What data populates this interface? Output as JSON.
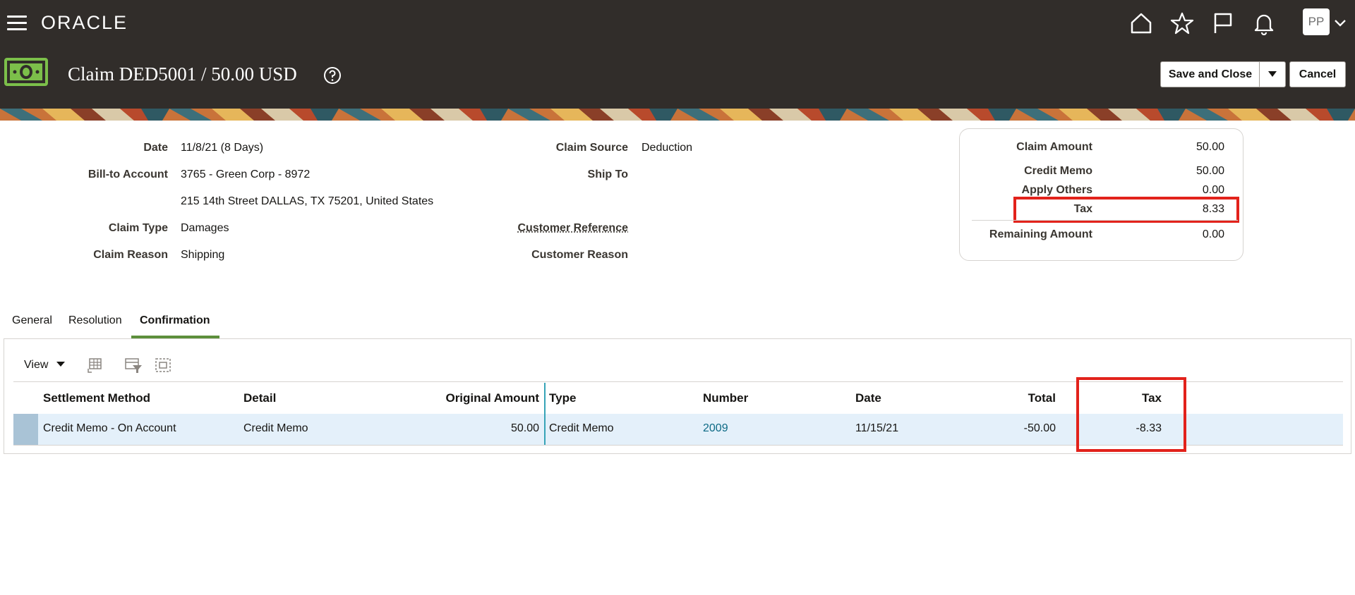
{
  "header": {
    "logo": "ORACLE",
    "avatar_initials": "PP",
    "title": "Claim DED5001 / 50.00 USD"
  },
  "actions": {
    "save_close": "Save and Close",
    "cancel": "Cancel"
  },
  "claim": {
    "date_label": "Date",
    "date_value": "11/8/21 (8 Days)",
    "bill_to_label": "Bill-to Account",
    "bill_to_value": "3765 - Green Corp - 8972",
    "address": "215 14th Street DALLAS, TX 75201, United States",
    "claim_type_label": "Claim Type",
    "claim_type_value": "Damages",
    "claim_reason_label": "Claim Reason",
    "claim_reason_value": "Shipping",
    "claim_source_label": "Claim Source",
    "claim_source_value": "Deduction",
    "ship_to_label": "Ship To",
    "customer_reference_label": "Customer Reference",
    "customer_reason_label": "Customer Reason"
  },
  "summary": {
    "claim_amount_label": "Claim Amount",
    "claim_amount": "50.00",
    "credit_memo_label": "Credit Memo",
    "credit_memo": "50.00",
    "apply_others_label": "Apply Others",
    "apply_others": "0.00",
    "tax_label": "Tax",
    "tax": "8.33",
    "remaining_label": "Remaining Amount",
    "remaining": "0.00"
  },
  "tabs": [
    {
      "label": "General"
    },
    {
      "label": "Resolution"
    },
    {
      "label": "Confirmation"
    }
  ],
  "toolbar": {
    "view_label": "View"
  },
  "table": {
    "columns": [
      "Settlement Method",
      "Detail",
      "Original Amount",
      "Type",
      "Number",
      "Date",
      "Total",
      "Tax"
    ],
    "rows": [
      {
        "settlement_method": "Credit Memo - On Account",
        "detail": "Credit Memo",
        "original_amount": "50.00",
        "type": "Credit Memo",
        "number": "2009",
        "date": "11/15/21",
        "total": "-50.00",
        "tax": "-8.33"
      }
    ]
  }
}
